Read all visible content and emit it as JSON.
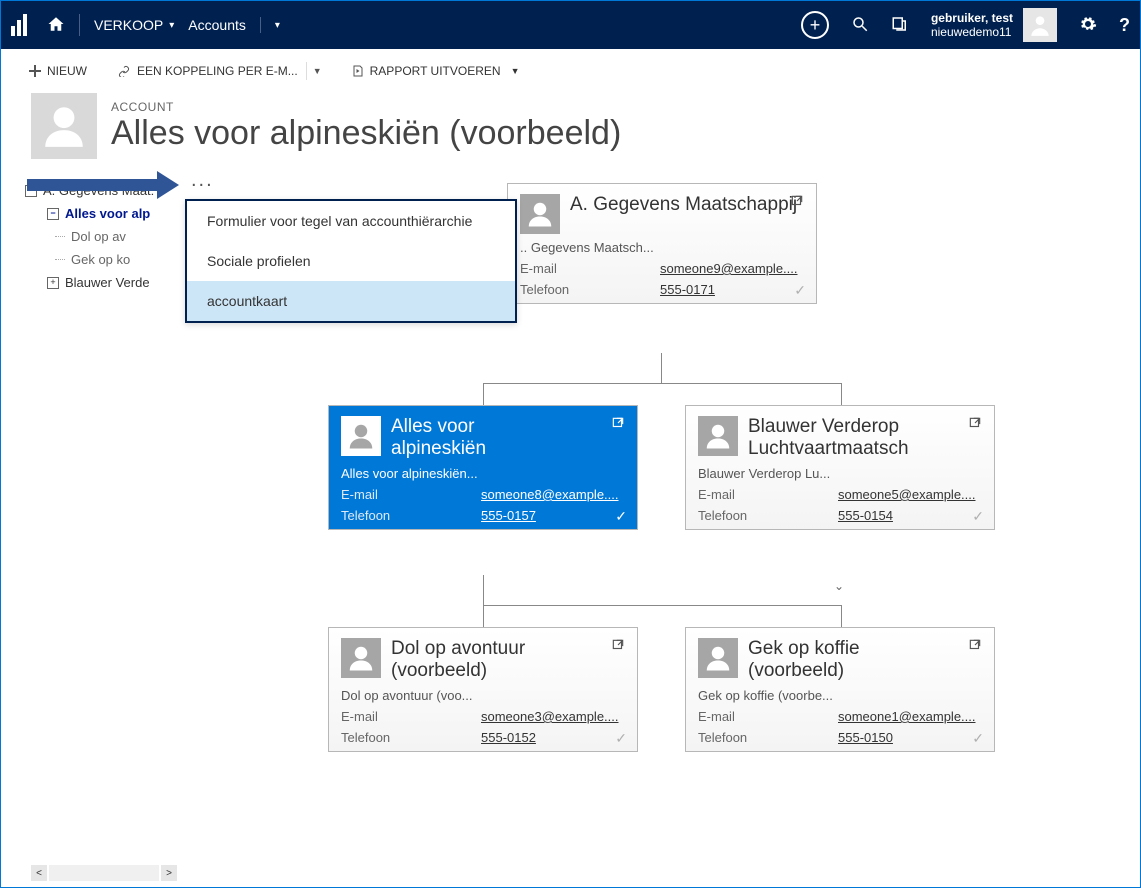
{
  "nav": {
    "module": "VERKOOP",
    "area": "Accounts",
    "user_name": "gebruiker, test",
    "user_org": "nieuwedemo11"
  },
  "toolbar": {
    "new": "NIEUW",
    "email_link": "EEN KOPPELING PER E-M...",
    "report": "RAPPORT UITVOEREN"
  },
  "page": {
    "kind": "ACCOUNT",
    "title": "Alles voor alpineskiën (voorbeeld)",
    "more": "..."
  },
  "popup": {
    "items": [
      "Formulier voor tegel van accounthiërarchie",
      "Sociale profielen",
      "accountkaart"
    ]
  },
  "tree": {
    "n0": "A. Gegevens Maat:",
    "n1": "Alles voor alp",
    "n2": "Dol op av",
    "n3": "Gek op ko",
    "n4": "Blauwer Verde"
  },
  "labels": {
    "email": "E-mail",
    "phone": "Telefoon"
  },
  "cards": {
    "root": {
      "name": "A. Gegevens Maatschappij",
      "sub": ".. Gegevens Maatsch...",
      "email": "someone9@example....",
      "phone": "555-0171"
    },
    "left": {
      "name": "Alles voor alpineskiën",
      "name_l1": "Alles voor",
      "name_l2": "alpineskiën",
      "sub": "Alles voor alpineskiën...",
      "email": "someone8@example....",
      "phone": "555-0157"
    },
    "right": {
      "name_l1": "Blauwer Verderop",
      "name_l2": "Luchtvaartmaatsch",
      "sub": "Blauwer Verderop Lu...",
      "email": "someone5@example....",
      "phone": "555-0154"
    },
    "bl": {
      "name_l1": "Dol op avontuur",
      "name_l2": "(voorbeeld)",
      "sub": "Dol op avontuur (voo...",
      "email": "someone3@example....",
      "phone": "555-0152"
    },
    "br": {
      "name_l1": "Gek op koffie",
      "name_l2": "(voorbeeld)",
      "sub": "Gek op koffie (voorbe...",
      "email": "someone1@example....",
      "phone": "555-0150"
    }
  }
}
